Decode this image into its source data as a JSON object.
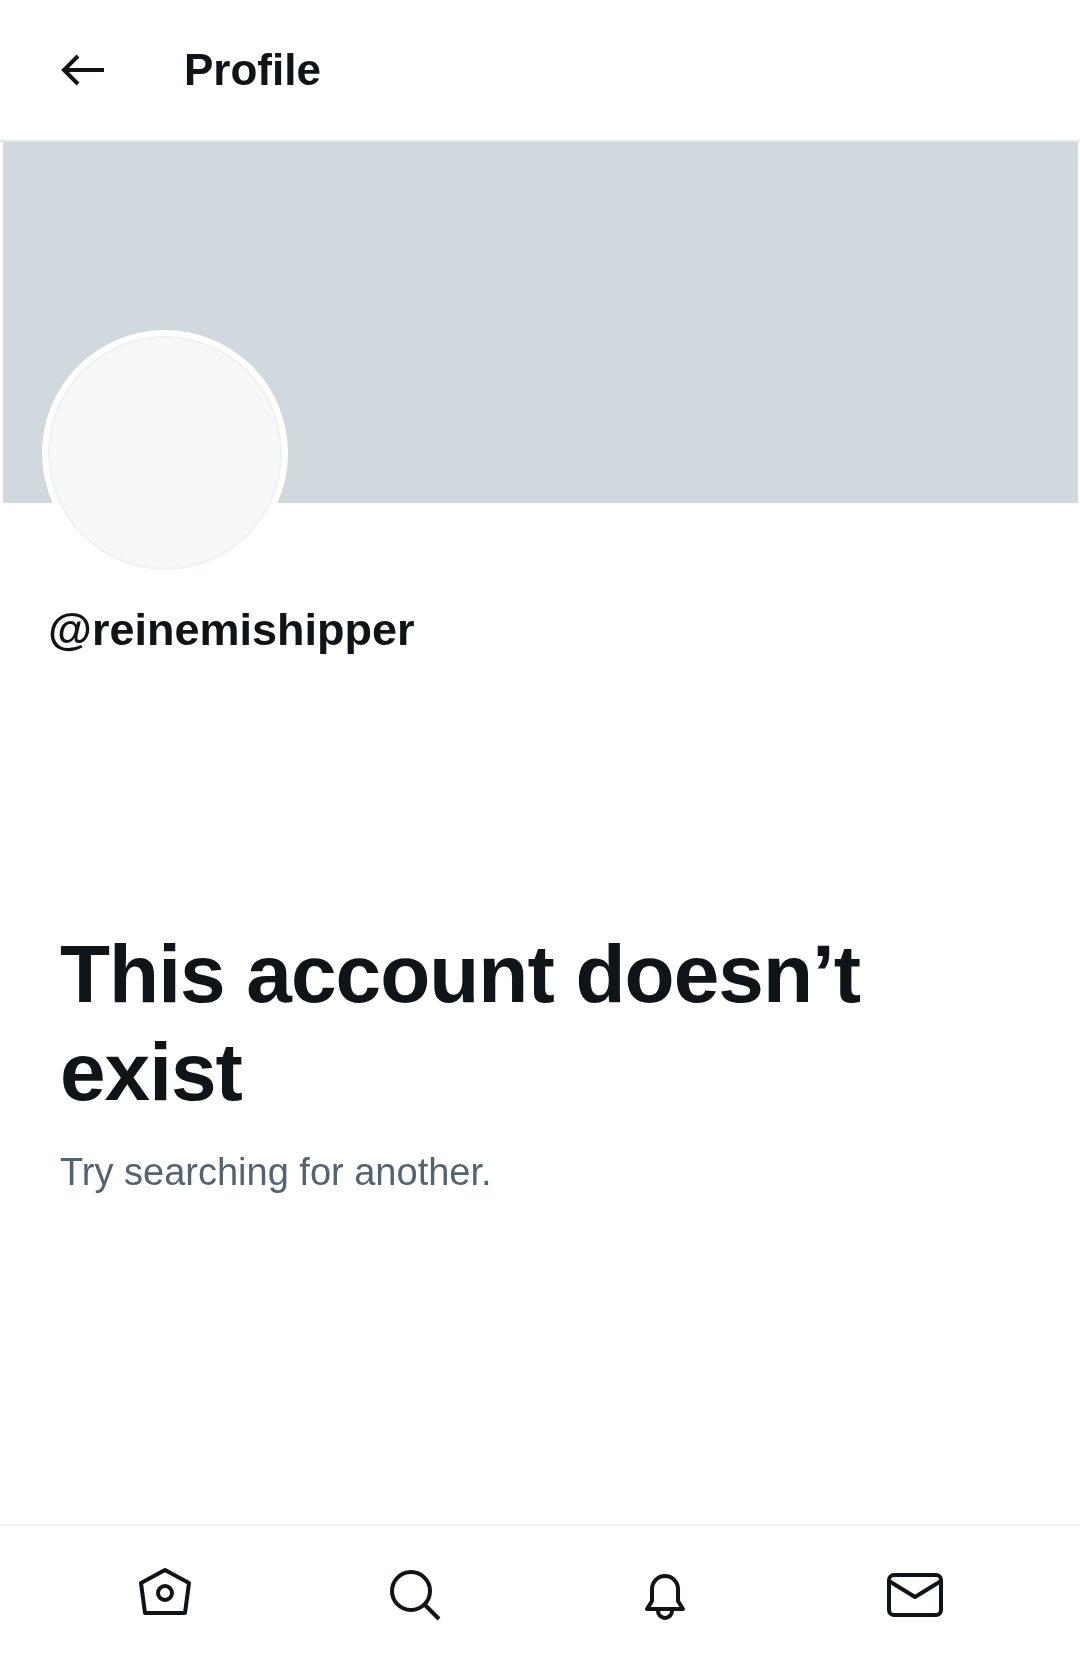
{
  "header": {
    "title": "Profile"
  },
  "profile": {
    "handle": "@reinemishipper"
  },
  "message": {
    "title": "This account doesn’t exist",
    "subtitle": "Try searching for another."
  },
  "bottom_nav": [
    {
      "kind": "home"
    },
    {
      "kind": "search"
    },
    {
      "kind": "notifications"
    },
    {
      "kind": "messages"
    }
  ]
}
